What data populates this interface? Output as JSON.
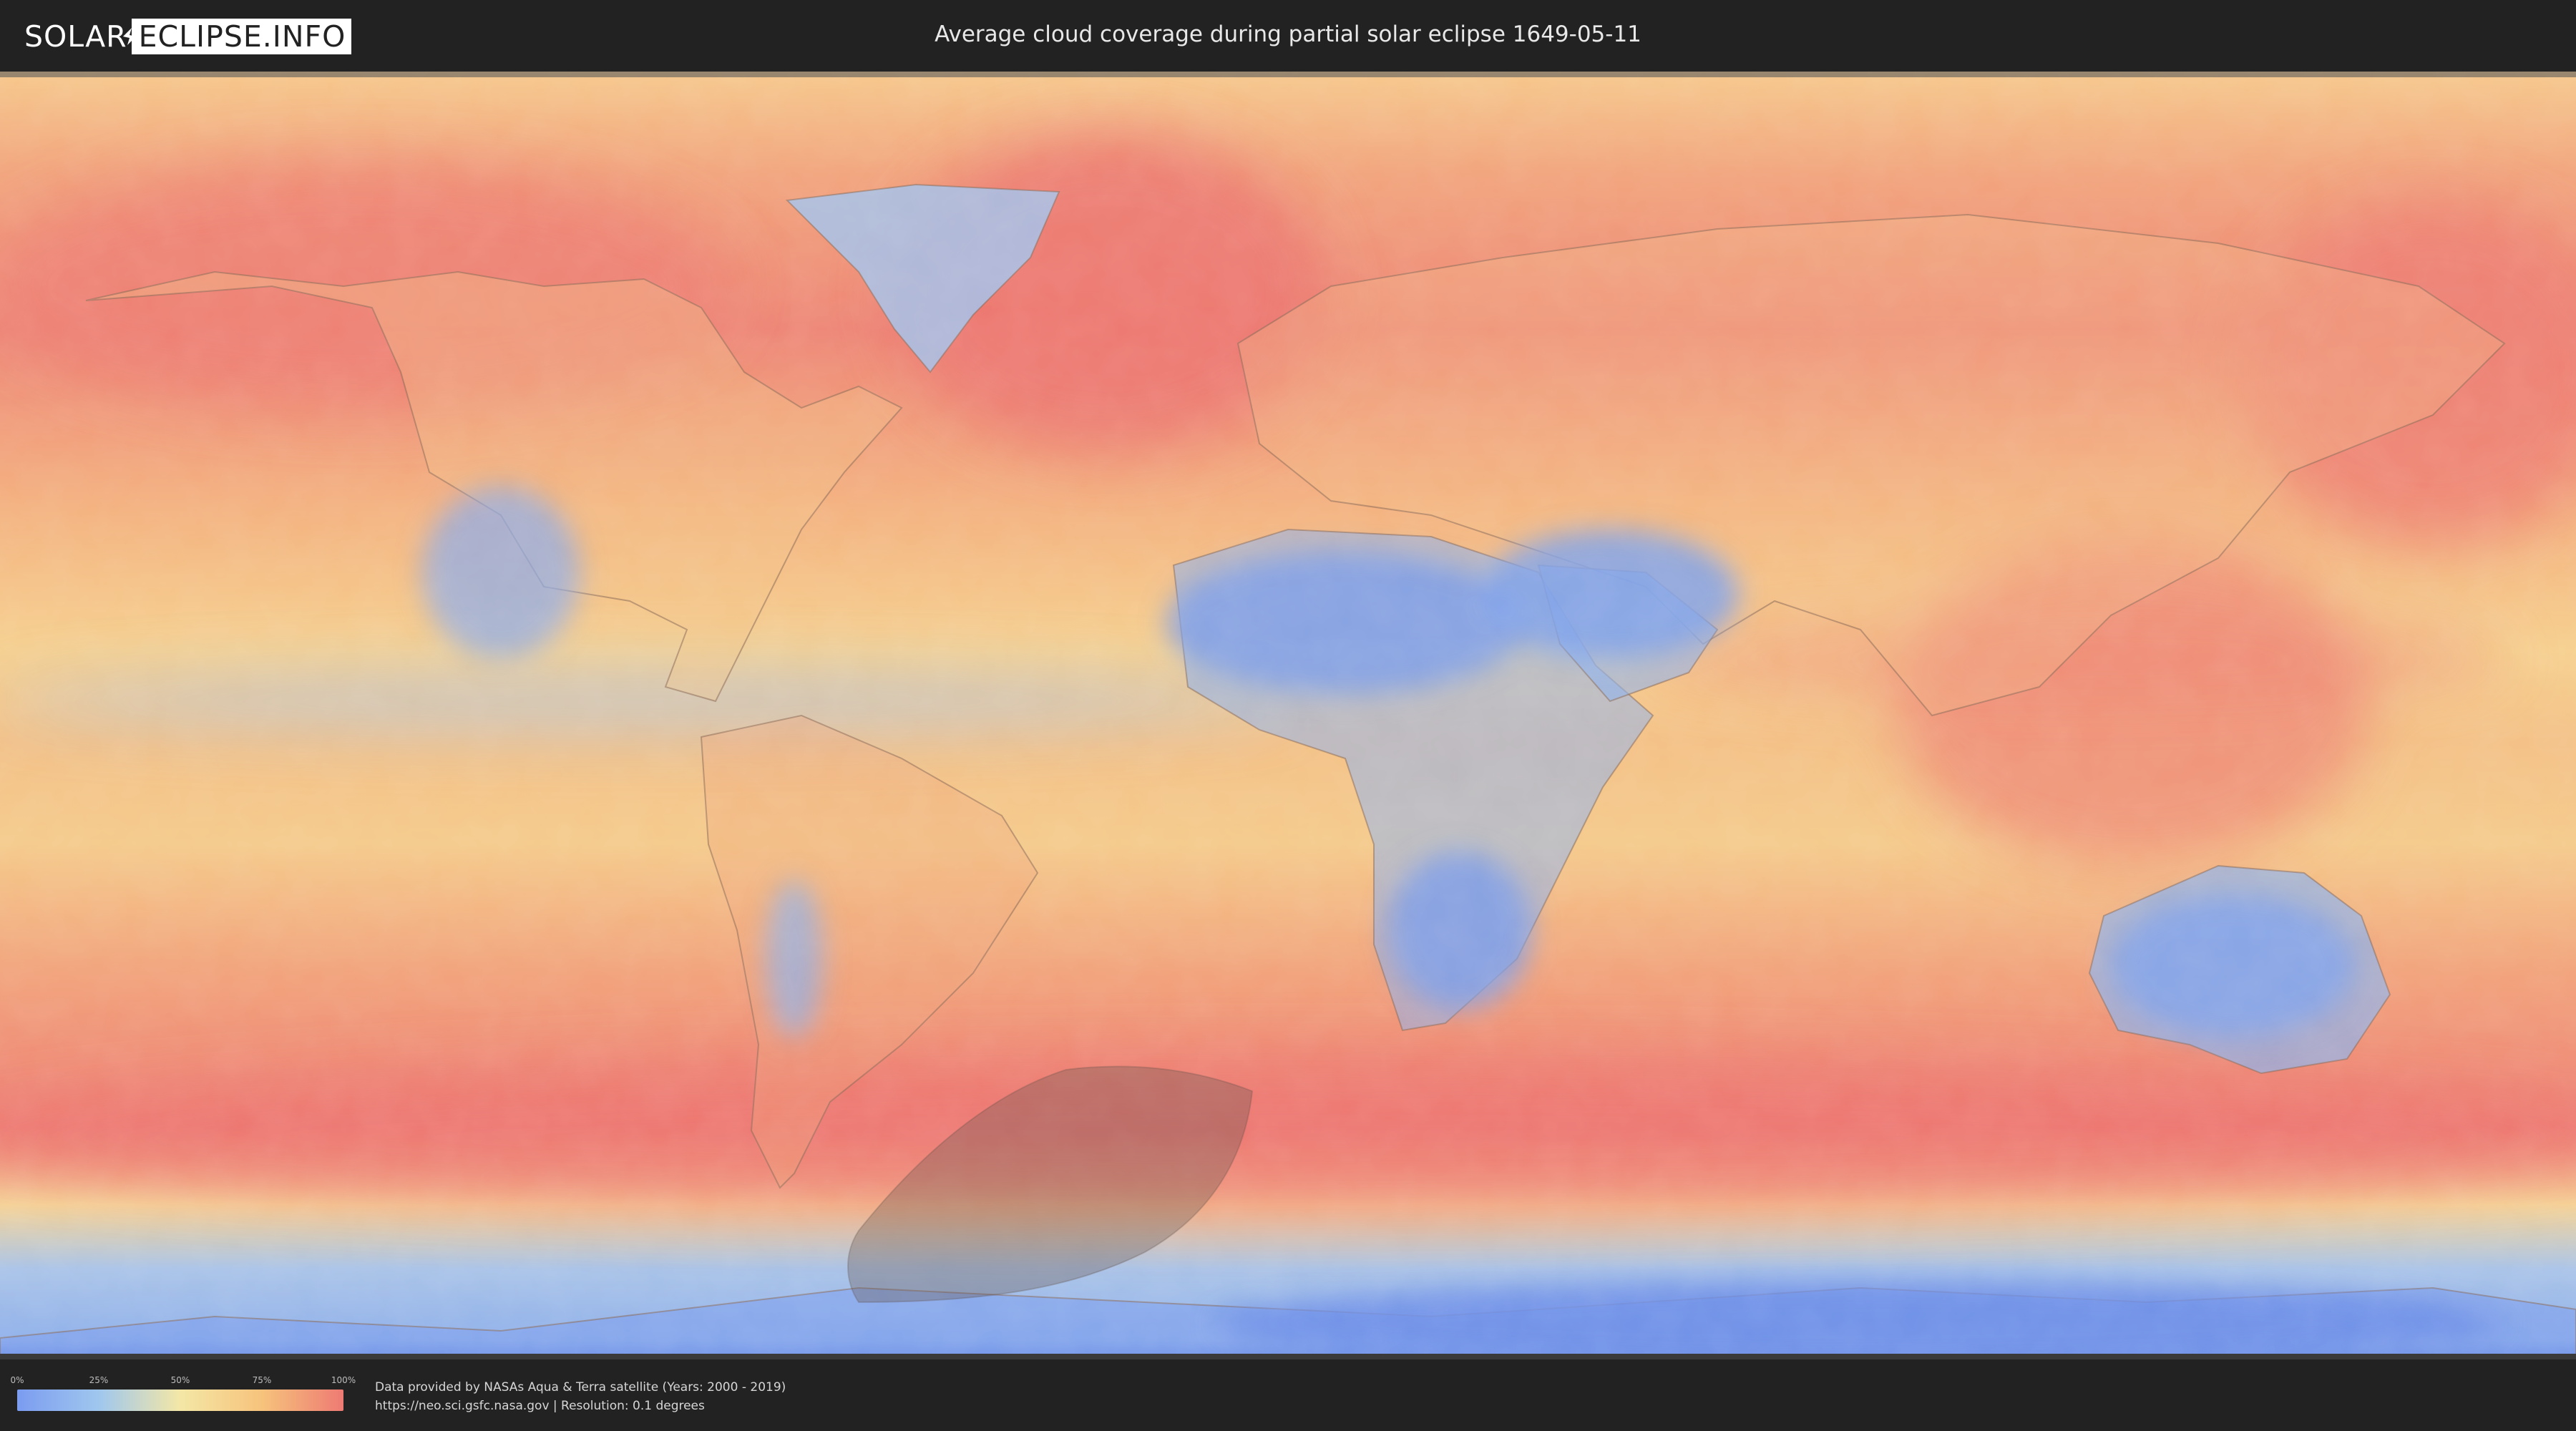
{
  "header": {
    "logo_left": "SOLAR",
    "logo_right": "ECLIPSE.INFO",
    "title": "Average cloud coverage during partial solar eclipse 1649-05-11"
  },
  "legend": {
    "ticks": [
      "0%",
      "25%",
      "50%",
      "75%",
      "100%"
    ],
    "gradient_colors": [
      "#7b9cf0",
      "#9fc7ee",
      "#f4e7a6",
      "#f6c37c",
      "#ee7a73"
    ]
  },
  "credits": {
    "line1": "Data provided by NASAs Aqua & Terra satellite (Years: 2000 - 2019)",
    "line2": "https://neo.sci.gsfc.nasa.gov | Resolution: 0.1 degrees"
  },
  "map": {
    "palette": {
      "ocean_high": "#ee8272",
      "ocean_mid": "#f5b684",
      "band_mid": "#f6d794",
      "clear_low": "#8fb4ec",
      "clear_lowest": "#6e90e8",
      "eclipse_shadow": "#6a5a52",
      "coast": "#8a6a56"
    }
  }
}
